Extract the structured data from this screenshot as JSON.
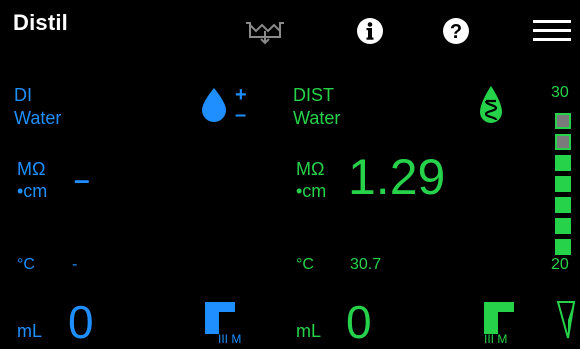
{
  "app": {
    "title": "Distil"
  },
  "icons": {
    "tank": "tank-icon",
    "info": "info-icon",
    "help": "help-icon",
    "menu": "hamburger-menu-icon",
    "di_drop": "water-drop-plus-minus-icon",
    "dist_drop": "distilled-water-drop-icon"
  },
  "colors": {
    "di": "#1f8fff",
    "dist": "#26d24a",
    "background": "#000000"
  },
  "di": {
    "label_line1": "DI",
    "label_line2": "Water",
    "resistivity_unit_line1": "MΩ",
    "resistivity_unit_line2": "•cm",
    "resistivity_value": "–",
    "temp_unit": "°C",
    "temp_value": "-",
    "volume_unit": "mL",
    "volume_value": "0",
    "level_label": "III M",
    "drop_plus": "+",
    "drop_minus": "–"
  },
  "dist": {
    "label_line1": "DIST",
    "label_line2": "Water",
    "resistivity_unit_line1": "MΩ",
    "resistivity_unit_line2": "•cm",
    "resistivity_value": "1.29",
    "temp_unit": "°C",
    "temp_value": "30.7",
    "volume_unit": "mL",
    "volume_value": "0",
    "level_label": "III M"
  },
  "gauge": {
    "max_label": "30",
    "min_label": "20",
    "segments": [
      "off",
      "off",
      "on",
      "on",
      "on",
      "on",
      "on"
    ]
  }
}
